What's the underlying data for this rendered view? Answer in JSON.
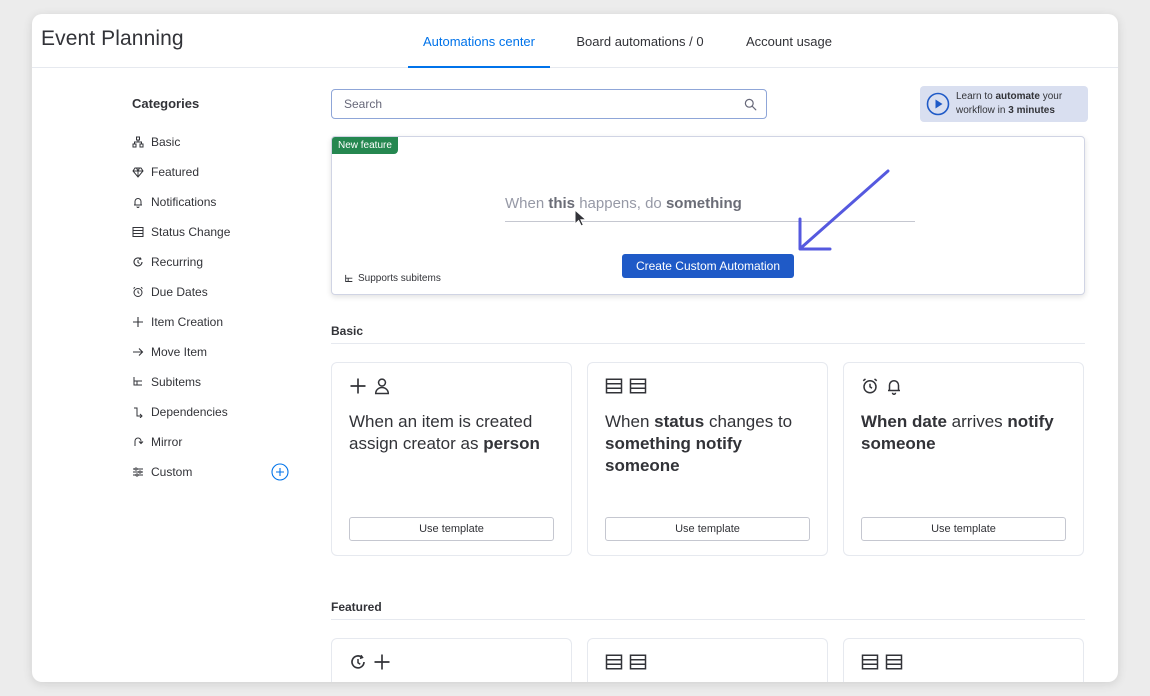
{
  "board": {
    "title": "Event Planning"
  },
  "tabs": [
    {
      "label": "Automations center",
      "active": true
    },
    {
      "label": "Board automations / 0",
      "active": false
    },
    {
      "label": "Account usage",
      "active": false
    }
  ],
  "categories": {
    "title": "Categories",
    "items": [
      {
        "label": "Basic",
        "icon": "basic-icon"
      },
      {
        "label": "Featured",
        "icon": "diamond-icon"
      },
      {
        "label": "Notifications",
        "icon": "bell-icon"
      },
      {
        "label": "Status Change",
        "icon": "status-icon"
      },
      {
        "label": "Recurring",
        "icon": "recurring-icon"
      },
      {
        "label": "Due Dates",
        "icon": "alarm-icon"
      },
      {
        "label": "Item Creation",
        "icon": "plus-icon"
      },
      {
        "label": "Move Item",
        "icon": "arrow-right-icon"
      },
      {
        "label": "Subitems",
        "icon": "subitems-icon"
      },
      {
        "label": "Dependencies",
        "icon": "dependency-icon"
      },
      {
        "label": "Mirror",
        "icon": "mirror-icon"
      },
      {
        "label": "Custom",
        "icon": "custom-icon"
      }
    ]
  },
  "search": {
    "placeholder": "Search",
    "value": ""
  },
  "learn": {
    "prefix": "Learn to ",
    "bold1": "automate",
    "mid": " your workflow in ",
    "bold2": "3 minutes"
  },
  "custom": {
    "badge": "New feature",
    "sentence": {
      "p1": "When ",
      "b1": "this",
      "p2": " happens, do ",
      "b2": "something"
    },
    "button": "Create Custom Automation",
    "subitems_note": "Supports subitems"
  },
  "sections": {
    "basic": {
      "title": "Basic",
      "cards": [
        {
          "icons": [
            "plus-icon",
            "person-icon"
          ],
          "parts": [
            [
              "When an item is created assign creator as ",
              false
            ],
            [
              "person",
              true
            ]
          ],
          "button": "Use template"
        },
        {
          "icons": [
            "status-icon",
            "status-icon"
          ],
          "parts": [
            [
              "When ",
              false
            ],
            [
              "status",
              true
            ],
            [
              " changes to ",
              false
            ],
            [
              "something notify someone",
              true
            ]
          ],
          "button": "Use template"
        },
        {
          "icons": [
            "alarm-icon",
            "bell-icon"
          ],
          "parts": [
            [
              "When date",
              true
            ],
            [
              " arrives ",
              false
            ],
            [
              "notify someone",
              true
            ]
          ],
          "button": "Use template"
        }
      ]
    },
    "featured": {
      "title": "Featured",
      "cards": [
        {
          "icons": [
            "recurring-icon",
            "plus-icon"
          ]
        },
        {
          "icons": [
            "status-icon",
            "status-icon"
          ]
        },
        {
          "icons": [
            "status-icon",
            "status-icon"
          ]
        }
      ]
    }
  },
  "colors": {
    "accent": "#0073ea",
    "primary_button": "#1f5ac7",
    "badge": "#258750",
    "arrow": "#5559df"
  }
}
